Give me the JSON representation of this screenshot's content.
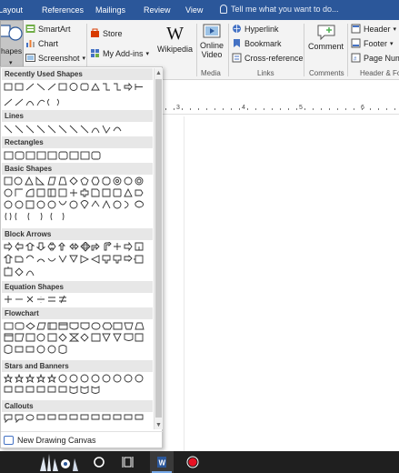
{
  "tabs": {
    "layout": "Layout",
    "references": "References",
    "mailings": "Mailings",
    "review": "Review",
    "view": "View",
    "tell_me": "Tell me what you want to do..."
  },
  "ribbon": {
    "shapes_label": "hapes",
    "smartart": "SmartArt",
    "chart": "Chart",
    "screenshot": "Screenshot",
    "store": "Store",
    "my_addins": "My Add-ins",
    "wikipedia": "Wikipedia",
    "online_video": "Online Video",
    "hyperlink": "Hyperlink",
    "bookmark": "Bookmark",
    "cross_reference": "Cross-reference",
    "comment": "Comment",
    "header": "Header",
    "footer": "Footer",
    "page_number": "Page Num",
    "group_media": "Media",
    "group_links": "Links",
    "group_comments": "Comments",
    "group_header_footer": "Header & Fo"
  },
  "ruler": {
    "numbers": [
      "3",
      "4",
      "5",
      "6"
    ]
  },
  "shapes_panel": {
    "sections": [
      "Recently Used Shapes",
      "Lines",
      "Rectangles",
      "Basic Shapes",
      "Block Arrows",
      "Equation Shapes",
      "Flowchart",
      "Stars and Banners",
      "Callouts"
    ],
    "new_canvas": "New Drawing Canvas"
  },
  "colors": {
    "tab_bar": "#2b579a",
    "ribbon": "#f3f3f3",
    "taskbar": "#1f1f1f",
    "record": "#e81123",
    "word": "#2b579a"
  },
  "icons": [
    "shapes-icon",
    "smartart-icon",
    "chart-icon",
    "screenshot-icon",
    "store-icon",
    "my-addins-icon",
    "wikipedia-icon",
    "online-video-icon",
    "hyperlink-icon",
    "bookmark-icon",
    "cross-reference-icon",
    "comment-icon",
    "header-icon",
    "footer-icon",
    "page-number-icon",
    "lightbulb-icon"
  ]
}
